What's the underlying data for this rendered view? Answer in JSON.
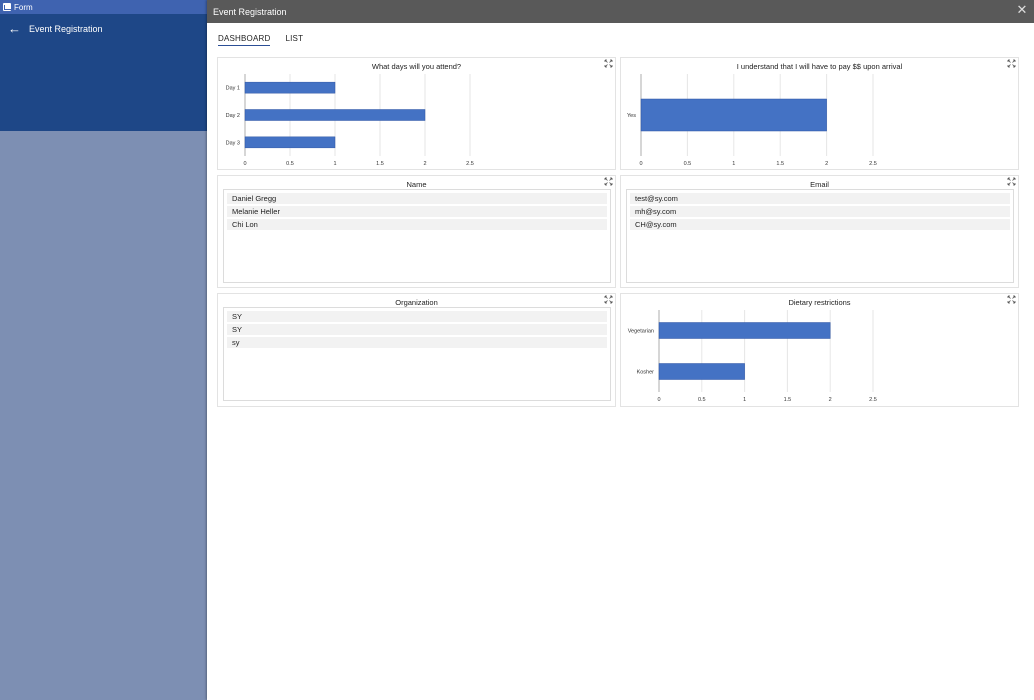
{
  "app": {
    "title": "Form",
    "back_label": "Event Registration"
  },
  "dialog": {
    "title": "Event Registration"
  },
  "tabs": [
    {
      "label": "DASHBOARD"
    },
    {
      "label": "LIST"
    }
  ],
  "cards": {
    "days": {
      "title": "What days will you attend?"
    },
    "pay": {
      "title": "I understand that I will have to pay $$ upon arrival"
    },
    "name": {
      "title": "Name",
      "items": [
        "Daniel Gregg",
        "Melanie Heller",
        "Chi Lon"
      ]
    },
    "email": {
      "title": "Email",
      "items": [
        "test@sy.com",
        "mh@sy.com",
        "CH@sy.com"
      ]
    },
    "org": {
      "title": "Organization",
      "items": [
        "SY",
        "SY",
        "sy"
      ]
    },
    "diet": {
      "title": "Dietary restrictions"
    }
  },
  "colors": {
    "bar": "#4472c4",
    "bar_border": "#2f55a4"
  },
  "chart_data": [
    {
      "type": "bar",
      "title": "What days will you attend?",
      "categories": [
        "Day 1",
        "Day 2",
        "Day 3"
      ],
      "values": [
        1,
        2,
        1
      ],
      "xlim": [
        0,
        2.5
      ],
      "ticks": [
        "0",
        "0.5",
        "1",
        "1.5",
        "2",
        "2.5"
      ],
      "grid": true
    },
    {
      "type": "bar",
      "title": "I understand that I will have to pay $$ upon arrival",
      "categories": [
        "Yes"
      ],
      "values": [
        2
      ],
      "xlim": [
        0,
        2.5
      ],
      "ticks": [
        "0",
        "0.5",
        "1",
        "1.5",
        "2",
        "2.5"
      ],
      "grid": true
    },
    {
      "type": "bar",
      "title": "Dietary restrictions",
      "categories": [
        "Vegetarian",
        "Kosher"
      ],
      "values": [
        2,
        1
      ],
      "xlim": [
        0,
        2.5
      ],
      "ticks": [
        "0",
        "0.5",
        "1",
        "1.5",
        "2",
        "2.5"
      ],
      "grid": true
    }
  ]
}
